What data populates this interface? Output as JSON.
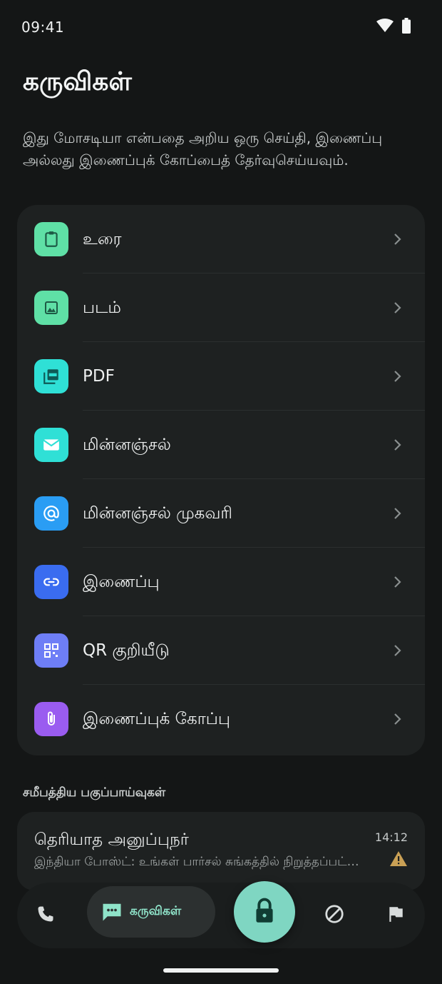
{
  "status_bar": {
    "time": "09:41"
  },
  "page": {
    "title": "கருவிகள்",
    "description": "இது மோசடியா என்பதை அறிய ஒரு செய்தி, இணைப்பு அல்லது இணைப்புக் கோப்பைத் தேர்வுசெய்யவும்."
  },
  "tools": [
    {
      "label": "உரை",
      "icon": "clipboard-icon",
      "color": "#5fe0a6"
    },
    {
      "label": "படம்",
      "icon": "image-icon",
      "color": "#5fe0a6"
    },
    {
      "label": "PDF",
      "icon": "pdf-icon",
      "color": "#2fe0d6"
    },
    {
      "label": "மின்னஞ்சல்",
      "icon": "mail-icon",
      "color": "#2fe0d6"
    },
    {
      "label": "மின்னஞ்சல் முகவரி",
      "icon": "at-icon",
      "color": "#2a9df4"
    },
    {
      "label": "இணைப்பு",
      "icon": "link-icon",
      "color": "#3a6cf0"
    },
    {
      "label": "QR குறியீடு",
      "icon": "qr-code-icon",
      "color": "#6e7ef6"
    },
    {
      "label": "இணைப்புக் கோப்பு",
      "icon": "paperclip-icon",
      "color": "#9a5cf0"
    }
  ],
  "recent": {
    "section_title": "சமீபத்திய பகுப்பாய்வுகள்",
    "items": [
      {
        "sender": "தெரியாத அனுப்புநர்",
        "preview": "இந்தியா போஸ்ட்: உங்கள் பார்சல் சுங்கத்தில் நிறுத்தப்பட்டுள்ளது",
        "time": "14:12",
        "status_icon": "warning-icon",
        "status_color": "#c9a055"
      }
    ]
  },
  "bottom_nav": {
    "items": [
      {
        "icon": "phone-icon"
      },
      {
        "icon": "chat-icon",
        "label": "கருவிகள்",
        "active": true
      },
      {
        "icon": "lock-icon"
      },
      {
        "icon": "block-icon"
      },
      {
        "icon": "flag-icon"
      }
    ],
    "accent_color": "#7fd6c2"
  }
}
